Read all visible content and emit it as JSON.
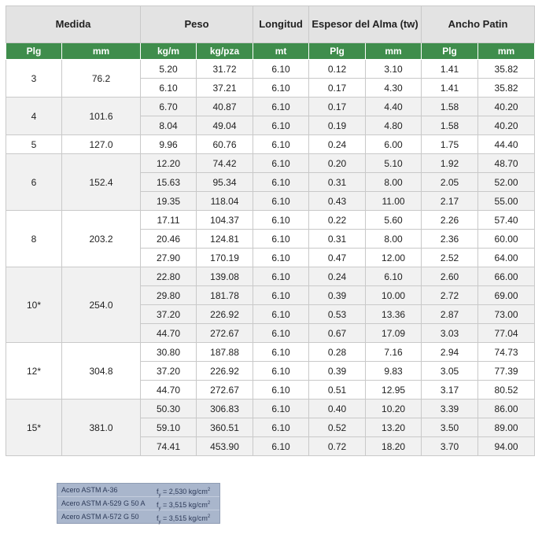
{
  "header": {
    "groups": [
      "Medida",
      "Peso",
      "Longitud",
      "Espesor del Alma (tw)",
      "Ancho Patin"
    ],
    "units": [
      "Plg",
      "mm",
      "kg/m",
      "kg/pza",
      "mt",
      "Plg",
      "mm",
      "Plg",
      "mm"
    ]
  },
  "groups": [
    {
      "plg": "3",
      "mm": "76.2",
      "rows": [
        [
          "5.20",
          "31.72",
          "6.10",
          "0.12",
          "3.10",
          "1.41",
          "35.82"
        ],
        [
          "6.10",
          "37.21",
          "6.10",
          "0.17",
          "4.30",
          "1.41",
          "35.82"
        ]
      ]
    },
    {
      "plg": "4",
      "mm": "101.6",
      "rows": [
        [
          "6.70",
          "40.87",
          "6.10",
          "0.17",
          "4.40",
          "1.58",
          "40.20"
        ],
        [
          "8.04",
          "49.04",
          "6.10",
          "0.19",
          "4.80",
          "1.58",
          "40.20"
        ]
      ]
    },
    {
      "plg": "5",
      "mm": "127.0",
      "rows": [
        [
          "9.96",
          "60.76",
          "6.10",
          "0.24",
          "6.00",
          "1.75",
          "44.40"
        ]
      ]
    },
    {
      "plg": "6",
      "mm": "152.4",
      "rows": [
        [
          "12.20",
          "74.42",
          "6.10",
          "0.20",
          "5.10",
          "1.92",
          "48.70"
        ],
        [
          "15.63",
          "95.34",
          "6.10",
          "0.31",
          "8.00",
          "2.05",
          "52.00"
        ],
        [
          "19.35",
          "118.04",
          "6.10",
          "0.43",
          "11.00",
          "2.17",
          "55.00"
        ]
      ]
    },
    {
      "plg": "8",
      "mm": "203.2",
      "rows": [
        [
          "17.11",
          "104.37",
          "6.10",
          "0.22",
          "5.60",
          "2.26",
          "57.40"
        ],
        [
          "20.46",
          "124.81",
          "6.10",
          "0.31",
          "8.00",
          "2.36",
          "60.00"
        ],
        [
          "27.90",
          "170.19",
          "6.10",
          "0.47",
          "12.00",
          "2.52",
          "64.00"
        ]
      ]
    },
    {
      "plg": "10*",
      "mm": "254.0",
      "rows": [
        [
          "22.80",
          "139.08",
          "6.10",
          "0.24",
          "6.10",
          "2.60",
          "66.00"
        ],
        [
          "29.80",
          "181.78",
          "6.10",
          "0.39",
          "10.00",
          "2.72",
          "69.00"
        ],
        [
          "37.20",
          "226.92",
          "6.10",
          "0.53",
          "13.36",
          "2.87",
          "73.00"
        ],
        [
          "44.70",
          "272.67",
          "6.10",
          "0.67",
          "17.09",
          "3.03",
          "77.04"
        ]
      ]
    },
    {
      "plg": "12*",
      "mm": "304.8",
      "rows": [
        [
          "30.80",
          "187.88",
          "6.10",
          "0.28",
          "7.16",
          "2.94",
          "74.73"
        ],
        [
          "37.20",
          "226.92",
          "6.10",
          "0.39",
          "9.83",
          "3.05",
          "77.39"
        ],
        [
          "44.70",
          "272.67",
          "6.10",
          "0.51",
          "12.95",
          "3.17",
          "80.52"
        ]
      ]
    },
    {
      "plg": "15*",
      "mm": "381.0",
      "rows": [
        [
          "50.30",
          "306.83",
          "6.10",
          "0.40",
          "10.20",
          "3.39",
          "86.00"
        ],
        [
          "59.10",
          "360.51",
          "6.10",
          "0.52",
          "13.20",
          "3.50",
          "89.00"
        ],
        [
          "74.41",
          "453.90",
          "6.10",
          "0.72",
          "18.20",
          "3.70",
          "94.00"
        ]
      ]
    }
  ],
  "steels": [
    {
      "name": "Acero ASTM A-36",
      "fy": "= 2,530 kg/cm"
    },
    {
      "name": "Acero ASTM A-529 G 50 A",
      "fy": "= 3,515 kg/cm"
    },
    {
      "name": "Acero ASTM A-572 G 50",
      "fy": "= 3,515 kg/cm"
    }
  ],
  "symbols": {
    "f": "f",
    "y": "y",
    "sq": "2"
  }
}
